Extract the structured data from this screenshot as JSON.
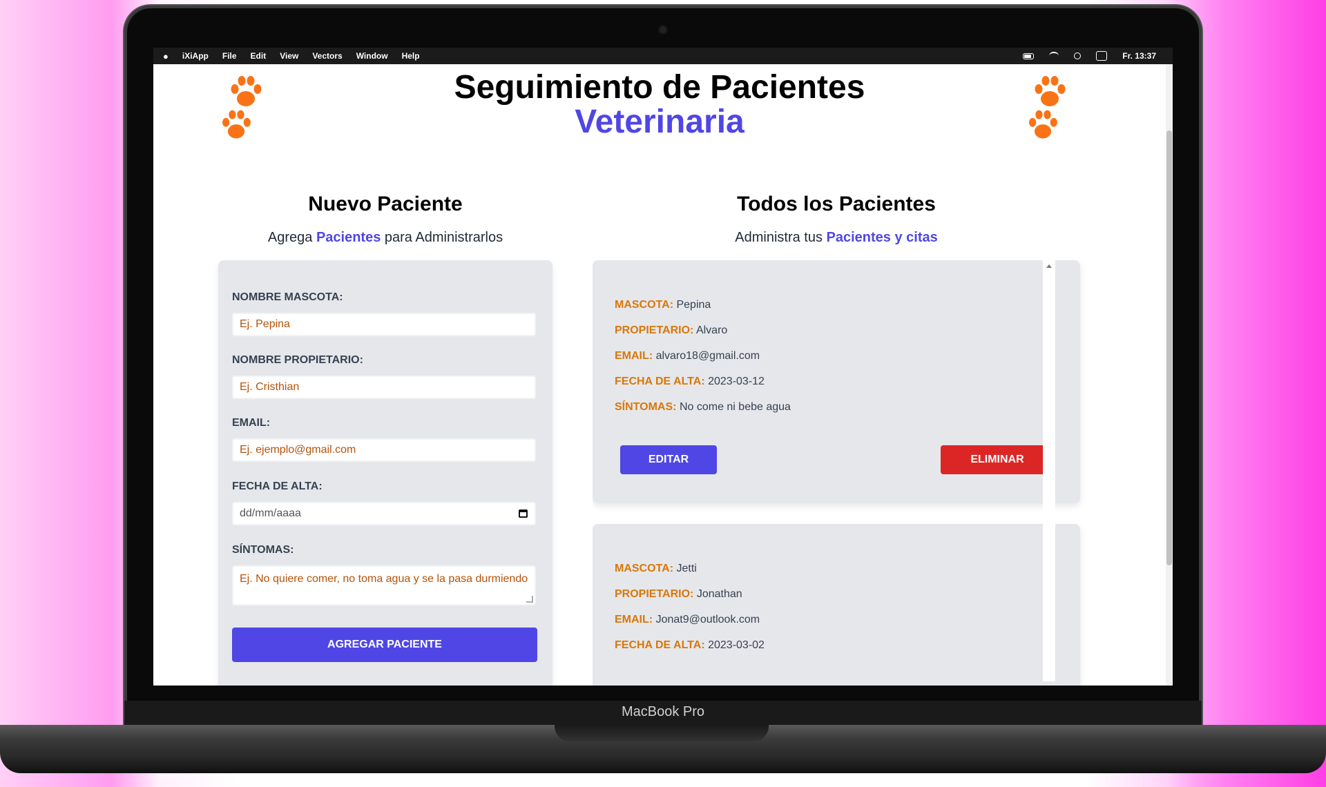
{
  "device": {
    "brand": "MacBook Pro"
  },
  "menubar": {
    "items": [
      "iXiApp",
      "File",
      "Edit",
      "View",
      "Vectors",
      "Window",
      "Help"
    ],
    "clock": "Fr. 13:37"
  },
  "header": {
    "title": "Seguimiento de Pacientes",
    "subtitle": "Veterinaria"
  },
  "form_section": {
    "title": "Nuevo Paciente",
    "sub_prefix": "Agrega ",
    "sub_highlight": "Pacientes",
    "sub_suffix": " para Administrarlos",
    "fields": [
      {
        "label": "NOMBRE MASCOTA:",
        "placeholder": "Ej. Pepina"
      },
      {
        "label": "NOMBRE PROPIETARIO:",
        "placeholder": "Ej. Cristhian"
      },
      {
        "label": "EMAIL:",
        "placeholder": "Ej. ejemplo@gmail.com"
      },
      {
        "label": "FECHA DE ALTA:",
        "placeholder": "dd/mm/aaaa"
      },
      {
        "label": "SÍNTOMAS:",
        "placeholder": "Ej. No quiere comer, no toma agua y se la pasa durmiendo"
      }
    ],
    "submit_label": "AGREGAR PACIENTE"
  },
  "list_section": {
    "title": "Todos los Pacientes",
    "sub_prefix": "Administra tus ",
    "sub_highlight": "Pacientes y citas",
    "patients": [
      {
        "mascota": "Pepina",
        "propietario": "Alvaro",
        "email": "alvaro18@gmail.com",
        "fecha": "2023-03-12",
        "sintomas": "No come ni bebe agua"
      },
      {
        "mascota": "Jetti",
        "propietario": "Jonathan",
        "email": "Jonat9@outlook.com",
        "fecha": "2023-03-02"
      }
    ],
    "keys": {
      "mascota": "MASCOTA:",
      "propietario": "PROPIETARIO:",
      "email": "EMAIL:",
      "fecha": "FECHA DE ALTA:",
      "sintomas": "SÍNTOMAS:"
    },
    "edit_label": "EDITAR",
    "delete_label": "ELIMINAR"
  },
  "colors": {
    "accent": "#4f46e5",
    "danger": "#dc2626",
    "label_orange": "#d97706",
    "paw_orange": "#f97316"
  }
}
